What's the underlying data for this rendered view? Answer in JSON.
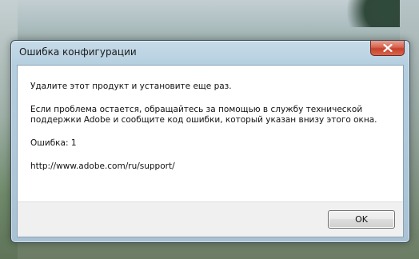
{
  "dialog": {
    "title": "Ошибка конфигурации",
    "message_line1": "Удалите этот продукт и установите еще раз.",
    "message_para2": "Если проблема остается, обращайтесь за помощью в службу технической поддержки Adobe и сообщите код ошибки, который указан внизу этого окна.",
    "error_label": "Ошибка: 1",
    "support_url": "http://www.adobe.com/ru/support/",
    "ok_label": "OK",
    "close_icon": "close-icon"
  }
}
